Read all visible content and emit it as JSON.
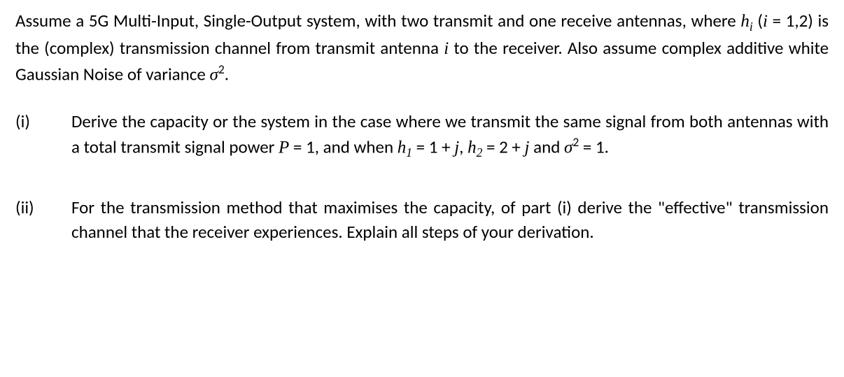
{
  "intro": {
    "t1": "Assume a 5G Multi-Input, Single-Output system, with two transmit and one receive antennas, where ",
    "hi_h": "h",
    "hi_sub": "i",
    "t2": " (",
    "i": "i",
    "t3": " = 1,2) is the (complex) transmission channel from transmit antenna ",
    "i2": "i",
    "t4": " to the receiver. Also assume complex additive white Gaussian Noise of variance ",
    "sigma": "σ",
    "sup2": "2",
    "t5": "."
  },
  "q1": {
    "label": "(i)",
    "t1": "Derive the capacity or the system in the case where we transmit the same signal from both antennas with a total transmit signal power ",
    "P": "P",
    "eq1": " = 1, and when ",
    "h1_h": "h",
    "h1_sub": "1",
    "h1_val": " = 1 + ",
    "j1": "j",
    "comma": ", ",
    "h2_h": "h",
    "h2_sub": "2",
    "h2_val": " = 2 + ",
    "j2": "j",
    "and": "  and ",
    "sigma": "σ",
    "sup2": "2",
    "eq_end": " = 1."
  },
  "q2": {
    "label": "(ii)",
    "t1": "For the transmission method that maximises the capacity, of part (i) derive the \"effective\" transmission channel that the receiver experiences. Explain all steps of your derivation."
  }
}
